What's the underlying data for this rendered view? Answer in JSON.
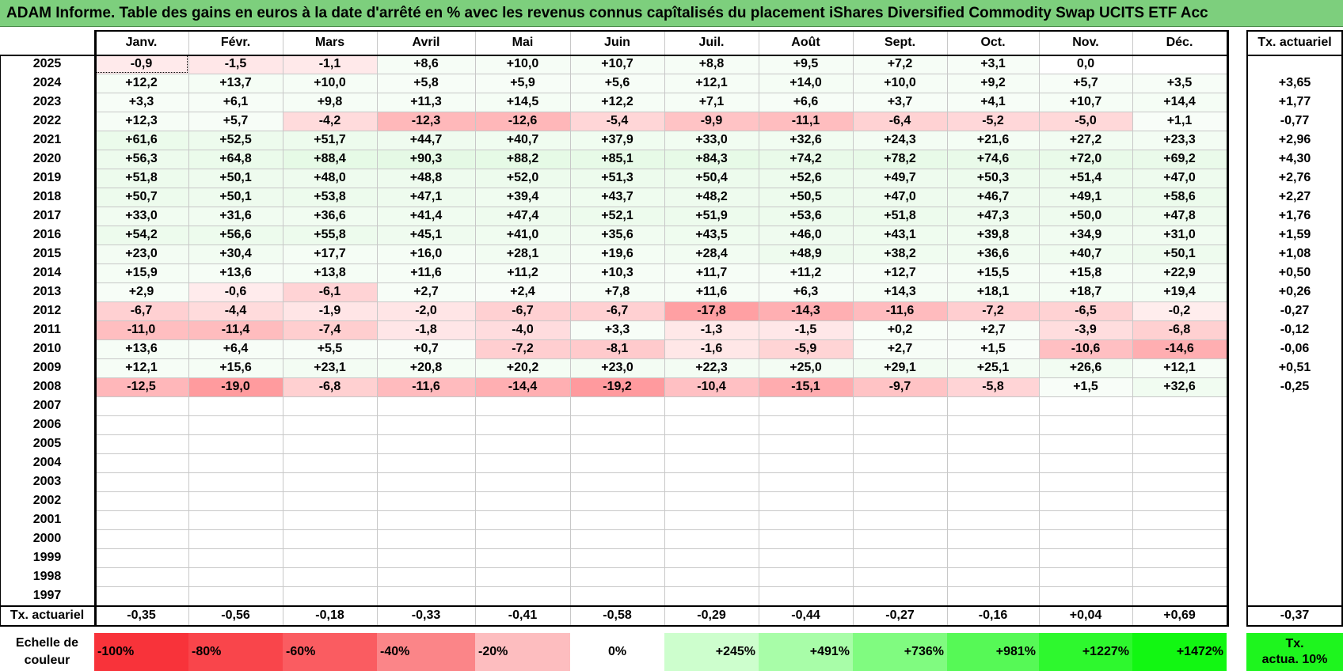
{
  "title": "ADAM Informe. Table des gains en euros à la date d'arrêté en % avec les revenus connus capîtalisés du placement iShares Diversified Commodity Swap UCITS ETF Acc",
  "months": [
    "Janv.",
    "Févr.",
    "Mars",
    "Avril",
    "Mai",
    "Juin",
    "Juil.",
    "Août",
    "Sept.",
    "Oct.",
    "Nov.",
    "Déc."
  ],
  "annual_header": "Tx. actuariel",
  "rows": [
    {
      "year": "2025",
      "values": [
        "-0,9",
        "-1,5",
        "-1,1",
        "+8,6",
        "+10,0",
        "+10,7",
        "+8,8",
        "+9,5",
        "+7,2",
        "+3,1",
        "0,0",
        ""
      ],
      "rate": ""
    },
    {
      "year": "2024",
      "values": [
        "+12,2",
        "+13,7",
        "+10,0",
        "+5,8",
        "+5,9",
        "+5,6",
        "+12,1",
        "+14,0",
        "+10,0",
        "+9,2",
        "+5,7",
        "+3,5"
      ],
      "rate": "+3,65"
    },
    {
      "year": "2023",
      "values": [
        "+3,3",
        "+6,1",
        "+9,8",
        "+11,3",
        "+14,5",
        "+12,2",
        "+7,1",
        "+6,6",
        "+3,7",
        "+4,1",
        "+10,7",
        "+14,4"
      ],
      "rate": "+1,77"
    },
    {
      "year": "2022",
      "values": [
        "+12,3",
        "+5,7",
        "-4,2",
        "-12,3",
        "-12,6",
        "-5,4",
        "-9,9",
        "-11,1",
        "-6,4",
        "-5,2",
        "-5,0",
        "+1,1"
      ],
      "rate": "-0,77"
    },
    {
      "year": "2021",
      "values": [
        "+61,6",
        "+52,5",
        "+51,7",
        "+44,7",
        "+40,7",
        "+37,9",
        "+33,0",
        "+32,6",
        "+24,3",
        "+21,6",
        "+27,2",
        "+23,3"
      ],
      "rate": "+2,96"
    },
    {
      "year": "2020",
      "values": [
        "+56,3",
        "+64,8",
        "+88,4",
        "+90,3",
        "+88,2",
        "+85,1",
        "+84,3",
        "+74,2",
        "+78,2",
        "+74,6",
        "+72,0",
        "+69,2"
      ],
      "rate": "+4,30"
    },
    {
      "year": "2019",
      "values": [
        "+51,8",
        "+50,1",
        "+48,0",
        "+48,8",
        "+52,0",
        "+51,3",
        "+50,4",
        "+52,6",
        "+49,7",
        "+50,3",
        "+51,4",
        "+47,0"
      ],
      "rate": "+2,76"
    },
    {
      "year": "2018",
      "values": [
        "+50,7",
        "+50,1",
        "+53,8",
        "+47,1",
        "+39,4",
        "+43,7",
        "+48,2",
        "+50,5",
        "+47,0",
        "+46,7",
        "+49,1",
        "+58,6"
      ],
      "rate": "+2,27"
    },
    {
      "year": "2017",
      "values": [
        "+33,0",
        "+31,6",
        "+36,6",
        "+41,4",
        "+47,4",
        "+52,1",
        "+51,9",
        "+53,6",
        "+51,8",
        "+47,3",
        "+50,0",
        "+47,8"
      ],
      "rate": "+1,76"
    },
    {
      "year": "2016",
      "values": [
        "+54,2",
        "+56,6",
        "+55,8",
        "+45,1",
        "+41,0",
        "+35,6",
        "+43,5",
        "+46,0",
        "+43,1",
        "+39,8",
        "+34,9",
        "+31,0"
      ],
      "rate": "+1,59"
    },
    {
      "year": "2015",
      "values": [
        "+23,0",
        "+30,4",
        "+17,7",
        "+16,0",
        "+28,1",
        "+19,6",
        "+28,4",
        "+48,9",
        "+38,2",
        "+36,6",
        "+40,7",
        "+50,1"
      ],
      "rate": "+1,08"
    },
    {
      "year": "2014",
      "values": [
        "+15,9",
        "+13,6",
        "+13,8",
        "+11,6",
        "+11,2",
        "+10,3",
        "+11,7",
        "+11,2",
        "+12,7",
        "+15,5",
        "+15,8",
        "+22,9"
      ],
      "rate": "+0,50"
    },
    {
      "year": "2013",
      "values": [
        "+2,9",
        "-0,6",
        "-6,1",
        "+2,7",
        "+2,4",
        "+7,8",
        "+11,6",
        "+6,3",
        "+14,3",
        "+18,1",
        "+18,7",
        "+19,4"
      ],
      "rate": "+0,26"
    },
    {
      "year": "2012",
      "values": [
        "-6,7",
        "-4,4",
        "-1,9",
        "-2,0",
        "-6,7",
        "-6,7",
        "-17,8",
        "-14,3",
        "-11,6",
        "-7,2",
        "-6,5",
        "-0,2"
      ],
      "rate": "-0,27"
    },
    {
      "year": "2011",
      "values": [
        "-11,0",
        "-11,4",
        "-7,4",
        "-1,8",
        "-4,0",
        "+3,3",
        "-1,3",
        "-1,5",
        "+0,2",
        "+2,7",
        "-3,9",
        "-6,8"
      ],
      "rate": "-0,12"
    },
    {
      "year": "2010",
      "values": [
        "+13,6",
        "+6,4",
        "+5,5",
        "+0,7",
        "-7,2",
        "-8,1",
        "-1,6",
        "-5,9",
        "+2,7",
        "+1,5",
        "-10,6",
        "-14,6"
      ],
      "rate": "-0,06"
    },
    {
      "year": "2009",
      "values": [
        "+12,1",
        "+15,6",
        "+23,1",
        "+20,8",
        "+20,2",
        "+23,0",
        "+22,3",
        "+25,0",
        "+29,1",
        "+25,1",
        "+26,6",
        "+12,1"
      ],
      "rate": "+0,51"
    },
    {
      "year": "2008",
      "values": [
        "-12,5",
        "-19,0",
        "-6,8",
        "-11,6",
        "-14,4",
        "-19,2",
        "-10,4",
        "-15,1",
        "-9,7",
        "-5,8",
        "+1,5",
        "+32,6"
      ],
      "rate": "-0,25"
    },
    {
      "year": "2007",
      "values": [
        "",
        "",
        "",
        "",
        "",
        "",
        "",
        "",
        "",
        "",
        "",
        ""
      ],
      "rate": ""
    },
    {
      "year": "2006",
      "values": [
        "",
        "",
        "",
        "",
        "",
        "",
        "",
        "",
        "",
        "",
        "",
        ""
      ],
      "rate": ""
    },
    {
      "year": "2005",
      "values": [
        "",
        "",
        "",
        "",
        "",
        "",
        "",
        "",
        "",
        "",
        "",
        ""
      ],
      "rate": ""
    },
    {
      "year": "2004",
      "values": [
        "",
        "",
        "",
        "",
        "",
        "",
        "",
        "",
        "",
        "",
        "",
        ""
      ],
      "rate": ""
    },
    {
      "year": "2003",
      "values": [
        "",
        "",
        "",
        "",
        "",
        "",
        "",
        "",
        "",
        "",
        "",
        ""
      ],
      "rate": ""
    },
    {
      "year": "2002",
      "values": [
        "",
        "",
        "",
        "",
        "",
        "",
        "",
        "",
        "",
        "",
        "",
        ""
      ],
      "rate": ""
    },
    {
      "year": "2001",
      "values": [
        "",
        "",
        "",
        "",
        "",
        "",
        "",
        "",
        "",
        "",
        "",
        ""
      ],
      "rate": ""
    },
    {
      "year": "2000",
      "values": [
        "",
        "",
        "",
        "",
        "",
        "",
        "",
        "",
        "",
        "",
        "",
        ""
      ],
      "rate": ""
    },
    {
      "year": "1999",
      "values": [
        "",
        "",
        "",
        "",
        "",
        "",
        "",
        "",
        "",
        "",
        "",
        ""
      ],
      "rate": ""
    },
    {
      "year": "1998",
      "values": [
        "",
        "",
        "",
        "",
        "",
        "",
        "",
        "",
        "",
        "",
        "",
        ""
      ],
      "rate": ""
    },
    {
      "year": "1997",
      "values": [
        "",
        "",
        "",
        "",
        "",
        "",
        "",
        "",
        "",
        "",
        "",
        ""
      ],
      "rate": ""
    }
  ],
  "footer": {
    "label": "Tx. actuariel",
    "values": [
      "-0,35",
      "-0,56",
      "-0,18",
      "-0,33",
      "-0,41",
      "-0,58",
      "-0,29",
      "-0,44",
      "-0,27",
      "-0,16",
      "+0,04",
      "+0,69"
    ],
    "rate": "-0,37"
  },
  "scale": {
    "label_line1": "Echelle de",
    "label_line2": "couleur",
    "steps": [
      {
        "text": "-100%",
        "color": "#f8333a",
        "align": "left"
      },
      {
        "text": "-80%",
        "color": "#f9454b",
        "align": "left"
      },
      {
        "text": "-60%",
        "color": "#fa5c61",
        "align": "left"
      },
      {
        "text": "-40%",
        "color": "#fb8588",
        "align": "left"
      },
      {
        "text": "-20%",
        "color": "#fdbdbf",
        "align": "left"
      },
      {
        "text": "0%",
        "color": "#ffffff",
        "align": "center"
      },
      {
        "text": "+245%",
        "color": "#cdfecd",
        "align": "right"
      },
      {
        "text": "+491%",
        "color": "#a8fda8",
        "align": "right"
      },
      {
        "text": "+736%",
        "color": "#80fb80",
        "align": "right"
      },
      {
        "text": "+981%",
        "color": "#56f956",
        "align": "right"
      },
      {
        "text": "+1227%",
        "color": "#2ef82e",
        "align": "right"
      },
      {
        "text": "+1472%",
        "color": "#12f712",
        "align": "right"
      }
    ],
    "tx10_line1": "Tx.",
    "tx10_line2": "actua. 10%",
    "tx10_color": "#1ef51e"
  },
  "colors": {
    "title_bg": "#7dcf7d",
    "negative_base": "#ff7b80",
    "positive_base": "#c8f8c8"
  }
}
